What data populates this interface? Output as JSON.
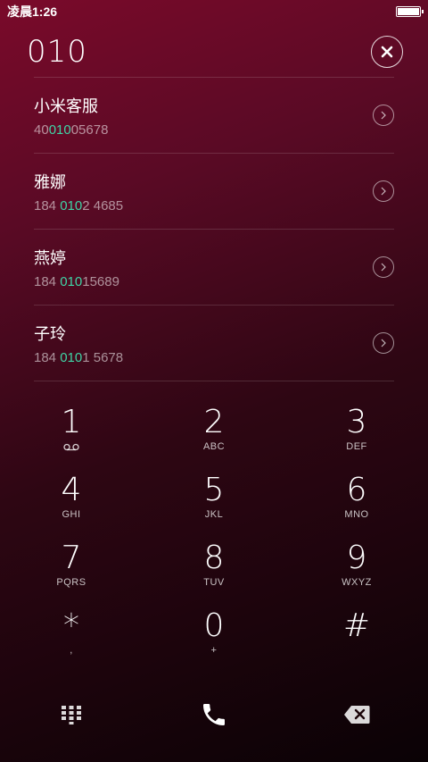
{
  "status_bar": {
    "time": "凌晨1:26"
  },
  "dialer": {
    "input_value": "010"
  },
  "contacts": [
    {
      "name": "小米客服",
      "num_pre": "40",
      "num_match": "010",
      "num_post": "05678"
    },
    {
      "name": "雅娜",
      "num_pre": "184 ",
      "num_match": "010",
      "num_post": "2 4685"
    },
    {
      "name": "燕婷",
      "num_pre": "184 ",
      "num_match": "010",
      "num_post": "15689"
    },
    {
      "name": "子玲",
      "num_pre": "184 ",
      "num_match": "010",
      "num_post": "1 5678"
    }
  ],
  "keypad": [
    {
      "digit": "1",
      "letters": ""
    },
    {
      "digit": "2",
      "letters": "ABC"
    },
    {
      "digit": "3",
      "letters": "DEF"
    },
    {
      "digit": "4",
      "letters": "GHI"
    },
    {
      "digit": "5",
      "letters": "JKL"
    },
    {
      "digit": "6",
      "letters": "MNO"
    },
    {
      "digit": "7",
      "letters": "PQRS"
    },
    {
      "digit": "8",
      "letters": "TUV"
    },
    {
      "digit": "9",
      "letters": "WXYZ"
    },
    {
      "digit": "*",
      "letters": ","
    },
    {
      "digit": "0",
      "letters": "+"
    },
    {
      "digit": "#",
      "letters": ""
    }
  ],
  "colors": {
    "match_highlight": "#3fd5a6",
    "background_top": "#7a0a2a",
    "background_bottom": "#0a0205"
  },
  "icons": {
    "clear": "close-icon",
    "detail": "chevron-right-icon",
    "voicemail": "voicemail-icon",
    "dialpad": "dialpad-icon",
    "call": "phone-icon",
    "backspace": "backspace-icon",
    "battery": "battery-icon"
  }
}
